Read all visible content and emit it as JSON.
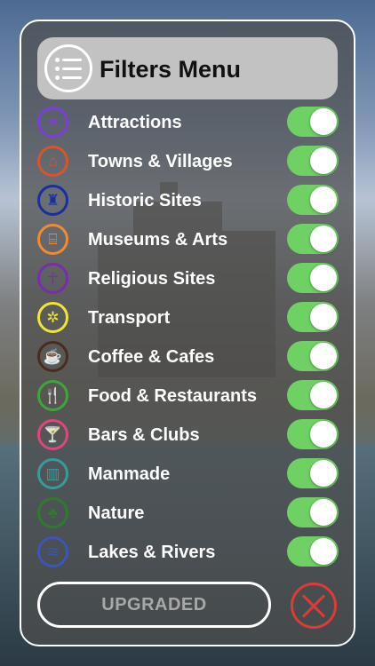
{
  "header": {
    "title": "Filters Menu",
    "icon": "menu-list-icon"
  },
  "categories": [
    {
      "label": "Attractions",
      "icon": "attractions-icon",
      "glyph": "✷",
      "color": "#7b3fd6",
      "enabled": true
    },
    {
      "label": "Towns & Villages",
      "icon": "town-icon",
      "glyph": "⌂",
      "color": "#d9542e",
      "enabled": true
    },
    {
      "label": "Historic Sites",
      "icon": "castle-icon",
      "glyph": "♜",
      "color": "#1a2f9c",
      "enabled": true
    },
    {
      "label": "Museums & Arts",
      "icon": "museum-icon",
      "glyph": "⌸",
      "color": "#f08a33",
      "enabled": true
    },
    {
      "label": "Religious Sites",
      "icon": "ankh-icon",
      "glyph": "☥",
      "color": "#7a2da8",
      "enabled": true
    },
    {
      "label": "Transport",
      "icon": "wheel-icon",
      "glyph": "✲",
      "color": "#f2e531",
      "enabled": true
    },
    {
      "label": "Coffee & Cafes",
      "icon": "coffee-cup-icon",
      "glyph": "☕",
      "color": "#4a2b1e",
      "enabled": true
    },
    {
      "label": "Food & Restaurants",
      "icon": "cutlery-icon",
      "glyph": "🍴",
      "color": "#3fa53a",
      "enabled": true
    },
    {
      "label": "Bars & Clubs",
      "icon": "cocktail-icon",
      "glyph": "🍸",
      "color": "#e0457f",
      "enabled": true
    },
    {
      "label": "Manmade",
      "icon": "building-icon",
      "glyph": "▥",
      "color": "#3a9a9a",
      "enabled": true
    },
    {
      "label": "Nature",
      "icon": "tree-icon",
      "glyph": "♣",
      "color": "#2f7a2f",
      "enabled": true
    },
    {
      "label": "Lakes & Rivers",
      "icon": "waves-icon",
      "glyph": "≋",
      "color": "#3d55b5",
      "enabled": true
    }
  ],
  "upgrade": {
    "label": "UPGRADED"
  },
  "close": {
    "icon": "close-x-icon",
    "color": "#e03a36"
  },
  "colors": {
    "toggle_on": "#6fd163",
    "panel": "#4e4e4e",
    "header": "#c2c2c2"
  }
}
